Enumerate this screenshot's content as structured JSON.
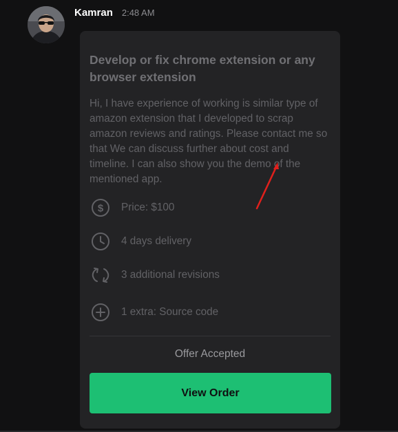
{
  "message": {
    "sender": "Kamran",
    "timestamp": "2:48 AM"
  },
  "offer": {
    "title": "Develop or fix chrome extension or any browser extension",
    "description": "Hi, I have experience of working is similar type of amazon extension that I developed to scrap amazon reviews and ratings. Please contact me so that We can discuss further about cost and timeline. I can also show you the demo of the mentioned app.",
    "features": {
      "price": {
        "icon": "dollar-icon",
        "label": "Price: $100"
      },
      "delivery": {
        "icon": "clock-icon",
        "label": "4 days delivery"
      },
      "revisions": {
        "icon": "refresh-icon",
        "label": "3 additional revisions"
      },
      "extra": {
        "icon": "plus-circle-icon",
        "label": "1 extra: Source code"
      }
    },
    "status": "Offer Accepted",
    "button_label": "View Order"
  },
  "colors": {
    "background": "#111112",
    "card": "#232325",
    "accent_green": "#1dbf73",
    "annotation_arrow": "#e0201c"
  }
}
